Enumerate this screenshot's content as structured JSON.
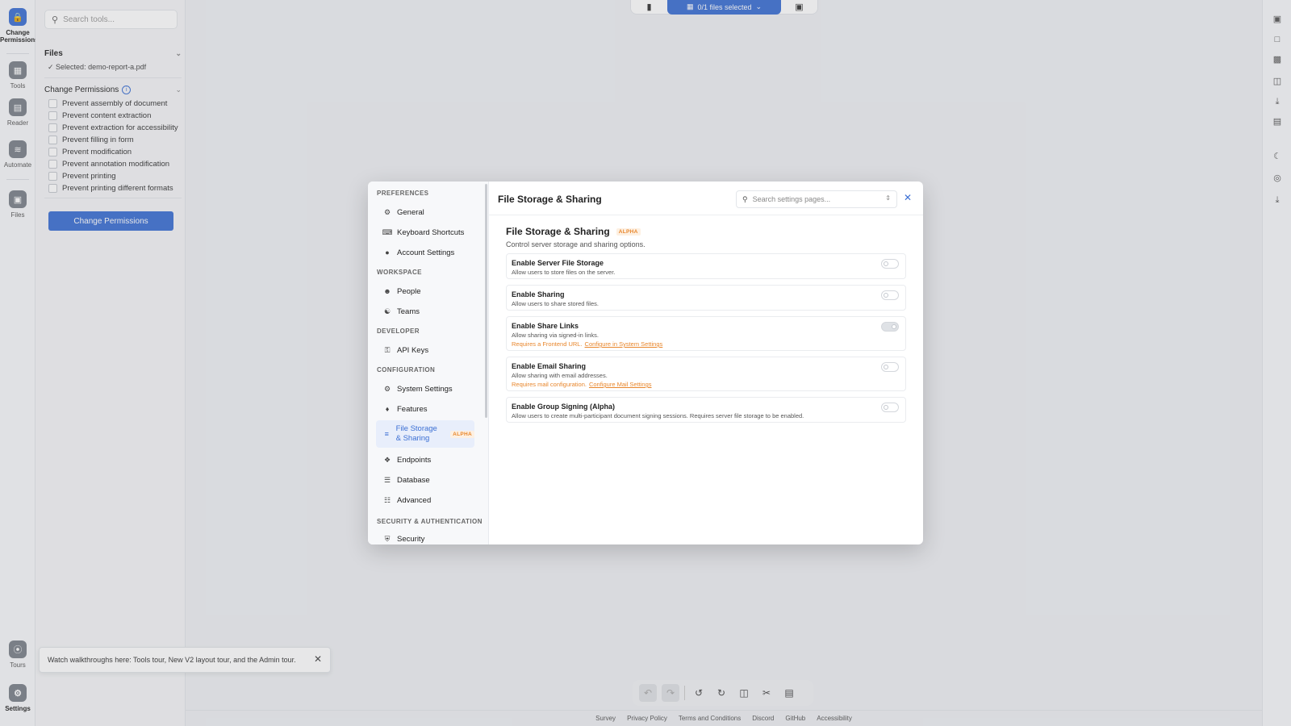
{
  "rail": {
    "items": [
      {
        "label": "Change\nPermissions",
        "icon": "lock-icon"
      },
      {
        "label": "Tools",
        "icon": "grid-icon"
      },
      {
        "label": "Reader",
        "icon": "book-icon"
      },
      {
        "label": "Automate",
        "icon": "automate-icon"
      },
      {
        "label": "Files",
        "icon": "folder-icon"
      },
      {
        "label": "Tours",
        "icon": "compass-icon"
      },
      {
        "label": "Settings",
        "icon": "gear-icon"
      }
    ]
  },
  "panel": {
    "search_placeholder": "Search tools...",
    "files_title": "Files",
    "selected_text": "✓ Selected: demo-report-a.pdf",
    "perm_title": "Change Permissions",
    "options": [
      "Prevent assembly of document",
      "Prevent content extraction",
      "Prevent extraction for accessibility",
      "Prevent filling in form",
      "Prevent modification",
      "Prevent annotation modification",
      "Prevent printing",
      "Prevent printing different formats"
    ],
    "action_button": "Change Permissions"
  },
  "topbar": {
    "files_selected": "0/1 files selected"
  },
  "toast": {
    "text": "Watch walkthroughs here: Tools tour, New V2 layout tour, and the Admin tour."
  },
  "footer": {
    "links": [
      "Survey",
      "Privacy Policy",
      "Terms and Conditions",
      "Discord",
      "GitHub",
      "Accessibility"
    ]
  },
  "modal": {
    "groups": {
      "preferences": "PREFERENCES",
      "workspace": "WORKSPACE",
      "developer": "DEVELOPER",
      "configuration": "CONFIGURATION",
      "security": "SECURITY & AUTHENTICATION"
    },
    "nav": {
      "general": "General",
      "keyboard": "Keyboard Shortcuts",
      "account": "Account Settings",
      "people": "People",
      "teams": "Teams",
      "apikeys": "API Keys",
      "system": "System Settings",
      "features": "Features",
      "filestorage": "File Storage & Sharing",
      "endpoints": "Endpoints",
      "database": "Database",
      "advanced": "Advanced",
      "security": "Security"
    },
    "alpha_badge": "ALPHA",
    "header_title": "File Storage & Sharing",
    "search_placeholder": "Search settings pages...",
    "section_title": "File Storage & Sharing",
    "section_desc": "Control server storage and sharing options.",
    "cards": [
      {
        "title": "Enable Server File Storage",
        "desc": "Allow users to store files on the server.",
        "warn": "",
        "link": "",
        "on": false
      },
      {
        "title": "Enable Sharing",
        "desc": "Allow users to share stored files.",
        "warn": "",
        "link": "",
        "on": false
      },
      {
        "title": "Enable Share Links",
        "desc": "Allow sharing via signed-in links.",
        "warn": "Requires a Frontend URL.",
        "link": "Configure in System Settings",
        "on": true
      },
      {
        "title": "Enable Email Sharing",
        "desc": "Allow sharing with email addresses.",
        "warn": "Requires mail configuration.",
        "link": "Configure Mail Settings",
        "on": false
      },
      {
        "title": "Enable Group Signing (Alpha)",
        "desc": "Allow users to create multi-participant document signing sessions. Requires server file storage to be enabled.",
        "warn": "",
        "link": "",
        "on": false
      }
    ]
  },
  "colors": {
    "accent": "#3b6fd4",
    "warning": "#e8862b"
  }
}
